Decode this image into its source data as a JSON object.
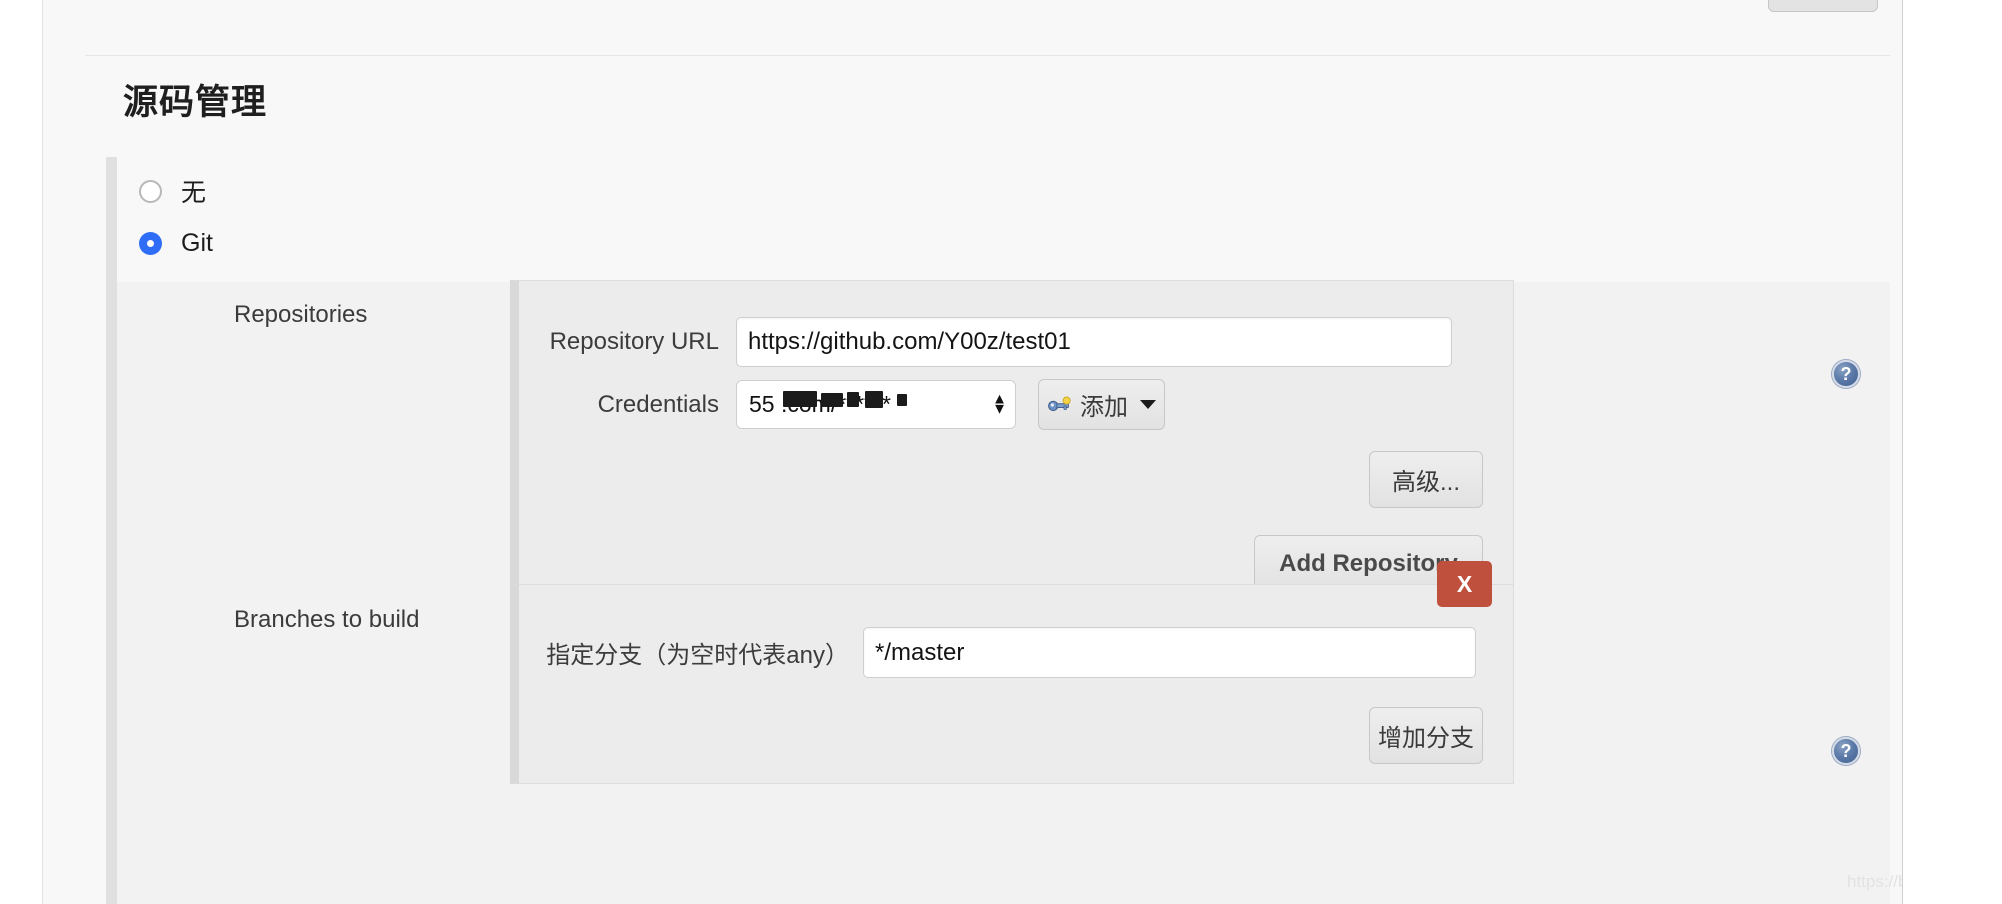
{
  "section": {
    "title": "源码管理"
  },
  "scm_options": [
    {
      "label": "无",
      "selected": false
    },
    {
      "label": "Git",
      "selected": true
    }
  ],
  "repositories": {
    "row_label": "Repositories",
    "url_field": {
      "label": "Repository URL",
      "value": "https://github.com/Y00z/test01"
    },
    "credentials_field": {
      "label": "Credentials",
      "value": "55                 .com/******",
      "add_button": "添加",
      "add_icon": "key-icon",
      "dropdown_icon": "chevron-down-icon"
    },
    "advanced_button": "高级...",
    "add_repository_button": "Add Repository"
  },
  "branches": {
    "row_label": "Branches to build",
    "branch_field": {
      "label": "指定分支（为空时代表any）",
      "value": "*/master"
    },
    "delete_button": "X",
    "add_branch_button": "增加分支"
  },
  "help": {
    "glyph": "?",
    "repositories": "?",
    "repository_url": "?",
    "branches": "?"
  },
  "watermark": "https://blog.csdn.net/yooz_",
  "colors": {
    "accent_radio": "#2f6df6",
    "danger": "#c0503e",
    "panel_bg": "#ececec",
    "page_bg": "#f8f8f8",
    "content_bg": "#f2f2f2"
  }
}
